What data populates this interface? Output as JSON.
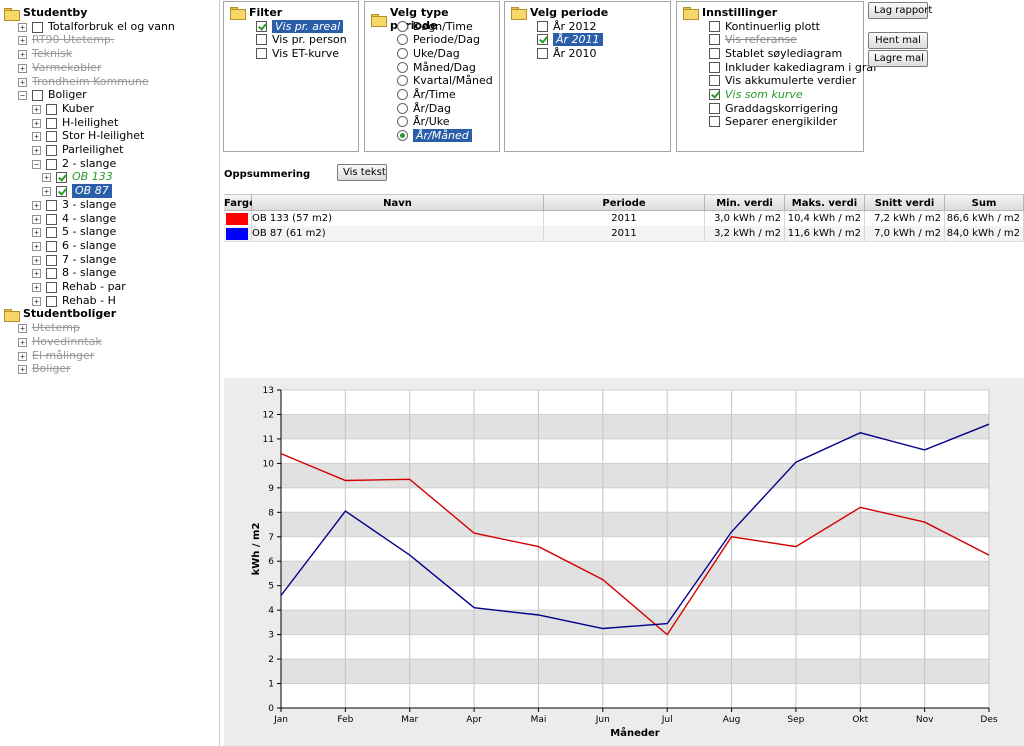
{
  "tree": {
    "items": [
      {
        "label": "Studentby",
        "style": "bold",
        "kind": "folder"
      },
      {
        "label": "Totalforbruk el og vann",
        "style": "normal",
        "kind": "check",
        "checked": false,
        "expander": "+"
      },
      {
        "label": "RT90 Utetemp.",
        "style": "strike",
        "kind": "leaf",
        "expander": "+"
      },
      {
        "label": "Teknisk",
        "style": "strike",
        "kind": "leaf",
        "expander": "+"
      },
      {
        "label": "Varmekabler",
        "style": "strike",
        "kind": "leaf",
        "expander": "+"
      },
      {
        "label": "Trondheim Kommune",
        "style": "strike",
        "kind": "leaf",
        "expander": "+"
      },
      {
        "label": "Boliger",
        "style": "normal",
        "kind": "check",
        "checked": false,
        "expander": "−"
      },
      {
        "label": "Kuber",
        "style": "normal",
        "kind": "check",
        "checked": false,
        "expander": "+"
      },
      {
        "label": "H-leilighet",
        "style": "normal",
        "kind": "check",
        "checked": false,
        "expander": "+"
      },
      {
        "label": "Stor H-leilighet",
        "style": "normal",
        "kind": "check",
        "checked": false,
        "expander": "+"
      },
      {
        "label": "Parleilighet",
        "style": "normal",
        "kind": "check",
        "checked": false,
        "expander": "+"
      },
      {
        "label": "2 - slange",
        "style": "normal",
        "kind": "check",
        "checked": false,
        "expander": "−"
      },
      {
        "label": "OB 133",
        "style": "green",
        "kind": "check",
        "checked": true,
        "expander": "+"
      },
      {
        "label": "OB 87",
        "style": "sel",
        "kind": "check",
        "checked": true,
        "expander": "+"
      },
      {
        "label": "3 - slange",
        "style": "normal",
        "kind": "check",
        "checked": false,
        "expander": "+"
      },
      {
        "label": "4 - slange",
        "style": "normal",
        "kind": "check",
        "checked": false,
        "expander": "+"
      },
      {
        "label": "5 - slange",
        "style": "normal",
        "kind": "check",
        "checked": false,
        "expander": "+"
      },
      {
        "label": "6 - slange",
        "style": "normal",
        "kind": "check",
        "checked": false,
        "expander": "+"
      },
      {
        "label": "7 - slange",
        "style": "normal",
        "kind": "check",
        "checked": false,
        "expander": "+"
      },
      {
        "label": "8 - slange",
        "style": "normal",
        "kind": "check",
        "checked": false,
        "expander": "+"
      },
      {
        "label": "Rehab - par",
        "style": "normal",
        "kind": "check",
        "checked": false,
        "expander": "+"
      },
      {
        "label": "Rehab - H",
        "style": "normal",
        "kind": "check",
        "checked": false,
        "expander": "+"
      },
      {
        "label": "Studentboliger",
        "style": "bold",
        "kind": "folder"
      },
      {
        "label": "Utetemp",
        "style": "strike",
        "kind": "leaf",
        "expander": "+"
      },
      {
        "label": "Hovedinntak",
        "style": "strike",
        "kind": "leaf",
        "expander": "+"
      },
      {
        "label": "El målinger",
        "style": "strike",
        "kind": "leaf",
        "expander": "+"
      },
      {
        "label": "Boliger",
        "style": "strike",
        "kind": "leaf",
        "expander": "+"
      }
    ]
  },
  "panels": {
    "filter": {
      "title": "Filter",
      "options": [
        {
          "label": "Vis pr. areal",
          "checked": true,
          "style": "sel"
        },
        {
          "label": "Vis pr. person",
          "checked": false,
          "style": "normal"
        },
        {
          "label": "Vis ET-kurve",
          "checked": false,
          "style": "normal"
        }
      ]
    },
    "periode_type": {
      "title": "Velg type periode",
      "options": [
        {
          "label": "Døgn/Time",
          "checked": false,
          "style": "normal"
        },
        {
          "label": "Periode/Dag",
          "checked": false,
          "style": "normal"
        },
        {
          "label": "Uke/Dag",
          "checked": false,
          "style": "normal"
        },
        {
          "label": "Måned/Dag",
          "checked": false,
          "style": "normal"
        },
        {
          "label": "Kvartal/Måned",
          "checked": false,
          "style": "normal"
        },
        {
          "label": "År/Time",
          "checked": false,
          "style": "normal"
        },
        {
          "label": "År/Dag",
          "checked": false,
          "style": "normal"
        },
        {
          "label": "År/Uke",
          "checked": false,
          "style": "normal"
        },
        {
          "label": "År/Måned",
          "checked": true,
          "style": "sel"
        }
      ]
    },
    "periode": {
      "title": "Velg periode",
      "options": [
        {
          "label": "År 2012",
          "checked": false,
          "style": "normal"
        },
        {
          "label": "År 2011",
          "checked": true,
          "style": "sel"
        },
        {
          "label": "År 2010",
          "checked": false,
          "style": "normal"
        }
      ]
    },
    "innstillinger": {
      "title": "Innstillinger",
      "options": [
        {
          "label": "Kontinuerlig plott",
          "checked": false,
          "style": "normal"
        },
        {
          "label": "Vis referanse",
          "checked": false,
          "style": "strike"
        },
        {
          "label": "Stablet søylediagram",
          "checked": false,
          "style": "normal"
        },
        {
          "label": "Inkluder kakediagram i graf",
          "checked": false,
          "style": "normal"
        },
        {
          "label": "Vis akkumulerte verdier",
          "checked": false,
          "style": "normal"
        },
        {
          "label": "Vis som kurve",
          "checked": true,
          "style": "green"
        },
        {
          "label": "Graddagskorrigering",
          "checked": false,
          "style": "normal"
        },
        {
          "label": "Separer energikilder",
          "checked": false,
          "style": "normal"
        }
      ]
    }
  },
  "buttons": {
    "lag_rapport": "Lag rapport",
    "hent_mal": "Hent mal",
    "lagre_mal": "Lagre mal",
    "vis_tekst": "Vis tekst"
  },
  "summary": {
    "title": "Oppsummering",
    "headers": [
      "Farge",
      "Navn",
      "Periode",
      "Min. verdi",
      "Maks. verdi",
      "Snitt verdi",
      "Sum"
    ],
    "rows": [
      {
        "color": "#ff0000",
        "navn": "OB 133 (57 m2)",
        "periode": "2011",
        "min": "3,0 kWh / m2",
        "maks": "10,4 kWh / m2",
        "snitt": "7,2 kWh / m2",
        "sum": "86,6 kWh / m2"
      },
      {
        "color": "#0000ff",
        "navn": "OB 87 (61 m2)",
        "periode": "2011",
        "min": "3,2 kWh / m2",
        "maks": "11,6 kWh / m2",
        "snitt": "7,0 kWh / m2",
        "sum": "84,0 kWh / m2"
      }
    ]
  },
  "chart_data": {
    "type": "line",
    "categories": [
      "Jan",
      "Feb",
      "Mar",
      "Apr",
      "Mai",
      "Jun",
      "Jul",
      "Aug",
      "Sep",
      "Okt",
      "Nov",
      "Des"
    ],
    "series": [
      {
        "color": "#d40000",
        "values": [
          10.4,
          9.3,
          9.35,
          7.15,
          6.6,
          5.25,
          3.0,
          7.0,
          6.6,
          8.2,
          7.6,
          6.25
        ]
      },
      {
        "color": "#00008b",
        "values": [
          4.6,
          8.05,
          6.25,
          4.1,
          3.8,
          3.25,
          3.45,
          7.2,
          10.05,
          11.25,
          10.55,
          11.6
        ]
      }
    ],
    "xlabel": "Måneder",
    "ylabel": "kWh / m2",
    "ylim": [
      0,
      13
    ],
    "yticks": [
      0,
      1,
      2,
      3,
      4,
      5,
      6,
      7,
      8,
      9,
      10,
      11,
      12,
      13
    ],
    "grid": true
  }
}
